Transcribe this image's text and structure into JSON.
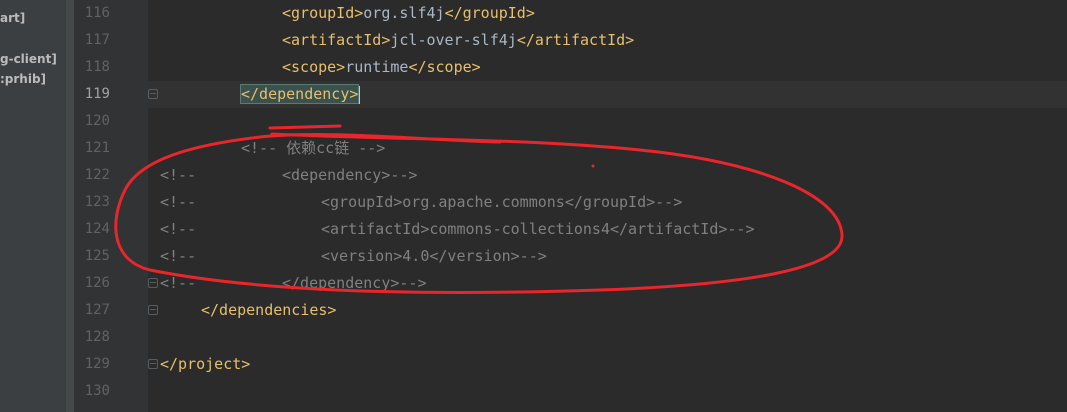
{
  "sidebar": {
    "items": [
      {
        "label": "art]"
      },
      {
        "label": "g-client]"
      },
      {
        "label": ":prhib]"
      }
    ]
  },
  "editor": {
    "line_numbers": [
      "116",
      "117",
      "118",
      "119",
      "120",
      "121",
      "122",
      "123",
      "124",
      "125",
      "126",
      "127",
      "128",
      "129",
      "130"
    ],
    "current_line": "119",
    "lines": {
      "l116": {
        "open": "<groupId>",
        "text": "org.slf4j",
        "close": "</groupId>"
      },
      "l117": {
        "open": "<artifactId>",
        "text": "jcl-over-slf4j",
        "close": "</artifactId>"
      },
      "l118": {
        "open": "<scope>",
        "text": "runtime",
        "close": "</scope>"
      },
      "l119": {
        "tag": "</dependency>"
      },
      "l121": {
        "comment": "<!-- 依赖cc链 -->"
      },
      "l122": {
        "prefix": "<!--",
        "rest": "<dependency>-->"
      },
      "l123": {
        "prefix": "<!--",
        "rest": "<groupId>org.apache.commons</groupId>-->"
      },
      "l124": {
        "prefix": "<!--",
        "rest": "<artifactId>commons-collections4</artifactId>-->"
      },
      "l125": {
        "prefix": "<!--",
        "rest": "<version>4.0</version>-->"
      },
      "l126": {
        "prefix": "<!--",
        "rest": "</dependency>-->"
      },
      "l127": {
        "tag": "</dependencies>"
      },
      "l129": {
        "tag": "</project>"
      }
    }
  },
  "colors": {
    "background": "#2b2b2b",
    "tag": "#e8bf6a",
    "text": "#a9b7c6",
    "comment": "#808080",
    "line_number": "#606366",
    "annotation": "#e8262b"
  }
}
